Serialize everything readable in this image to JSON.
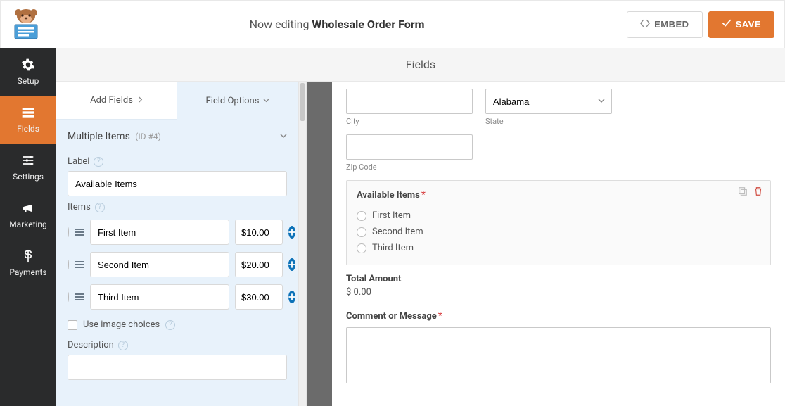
{
  "topbar": {
    "editing_prefix": "Now editing ",
    "form_name": "Wholesale Order Form",
    "embed_label": "EMBED",
    "save_label": "SAVE"
  },
  "sidebar": {
    "items": [
      {
        "label": "Setup"
      },
      {
        "label": "Fields"
      },
      {
        "label": "Settings"
      },
      {
        "label": "Marketing"
      },
      {
        "label": "Payments"
      }
    ],
    "active_index": 1
  },
  "header_strip": "Fields",
  "panel": {
    "tabs": {
      "add": "Add Fields",
      "options": "Field Options"
    },
    "section": {
      "title": "Multiple Items",
      "id_text": "(ID #4)"
    },
    "label_heading": "Label",
    "label_value": "Available Items",
    "items_heading": "Items",
    "items": [
      {
        "name": "First Item",
        "price": "$10.00"
      },
      {
        "name": "Second Item",
        "price": "$20.00"
      },
      {
        "name": "Third Item",
        "price": "$30.00"
      }
    ],
    "use_image_choices": "Use image choices",
    "description_heading": "Description"
  },
  "preview": {
    "city_label": "City",
    "state_value": "Alabama",
    "state_label": "State",
    "zip_label": "Zip Code",
    "available_title": "Available Items",
    "radio_items": [
      "First Item",
      "Second Item",
      "Third Item"
    ],
    "total_label": "Total Amount",
    "total_value": "$ 0.00",
    "comment_label": "Comment or Message"
  }
}
